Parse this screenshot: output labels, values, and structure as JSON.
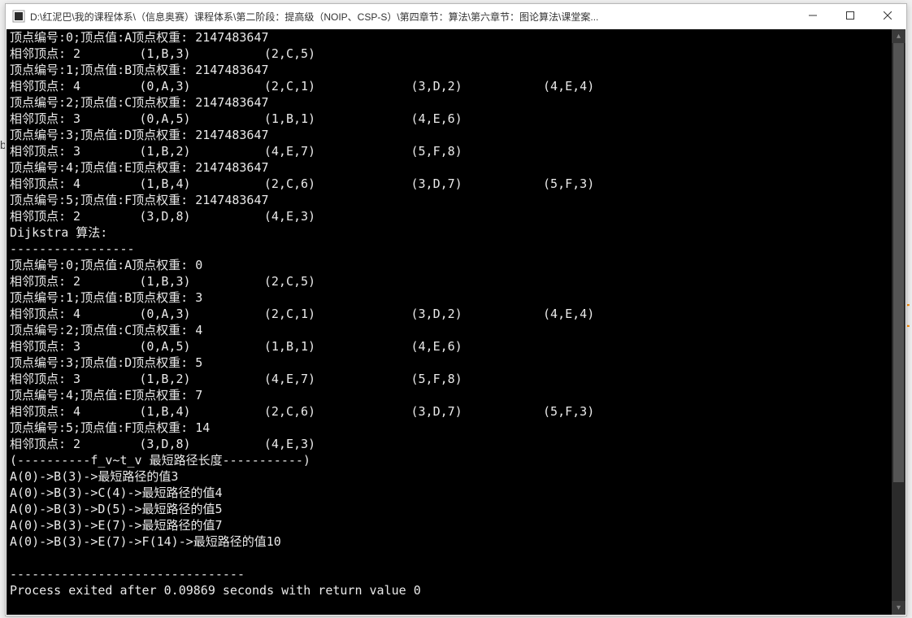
{
  "window": {
    "title": "D:\\红泥巴\\我的课程体系\\（信息奥赛）课程体系\\第二阶段：提高级（NOIP、CSP-S）\\第四章节：算法\\第六章节：图论算法\\课堂案..."
  },
  "console_lines": [
    "顶点编号:0;顶点值:A顶点权重: 2147483647",
    "相邻顶点: 2     (1,B,3)         (2,C,5)",
    "顶点编号:1;顶点值:B顶点权重: 2147483647",
    "相邻顶点: 4     (0,A,3)         (2,C,1)         (3,D,2)         (4,E,4)",
    "顶点编号:2;顶点值:C顶点权重: 2147483647",
    "相邻顶点: 3     (0,A,5)         (1,B,1)         (4,E,6)",
    "顶点编号:3;顶点值:D顶点权重: 2147483647",
    "相邻顶点: 3     (1,B,2)         (4,E,7)         (5,F,8)",
    "顶点编号:4;顶点值:E顶点权重: 2147483647",
    "相邻顶点: 4     (1,B,4)         (2,C,6)         (3,D,7)         (5,F,3)",
    "顶点编号:5;顶点值:F顶点权重: 2147483647",
    "相邻顶点: 2     (3,D,8)         (4,E,3)",
    "Dijkstra 算法:",
    "-----------------",
    "顶点编号:0;顶点值:A顶点权重: 0",
    "相邻顶点: 2     (1,B,3)         (2,C,5)",
    "顶点编号:1;顶点值:B顶点权重: 3",
    "相邻顶点: 4     (0,A,3)         (2,C,1)         (3,D,2)         (4,E,4)",
    "顶点编号:2;顶点值:C顶点权重: 4",
    "相邻顶点: 3     (0,A,5)         (1,B,1)         (4,E,6)",
    "顶点编号:3;顶点值:D顶点权重: 5",
    "相邻顶点: 3     (1,B,2)         (4,E,7)         (5,F,8)",
    "顶点编号:4;顶点值:E顶点权重: 7",
    "相邻顶点: 4     (1,B,4)         (2,C,6)         (3,D,7)         (5,F,3)",
    "顶点编号:5;顶点值:F顶点权重: 14",
    "相邻顶点: 2     (3,D,8)         (4,E,3)",
    "(----------f_v~t_v 最短路径长度-----------)",
    "A(0)->B(3)->最短路径的值3",
    "A(0)->B(3)->C(4)->最短路径的值4",
    "A(0)->B(3)->D(5)->最短路径的值5",
    "A(0)->B(3)->E(7)->最短路径的值7",
    "A(0)->B(3)->E(7)->F(14)->最短路径的值10",
    "",
    "--------------------------------",
    "Process exited after 0.09869 seconds with return value 0"
  ],
  "edge_chars": {
    "b": "b",
    "brace": "{"
  }
}
